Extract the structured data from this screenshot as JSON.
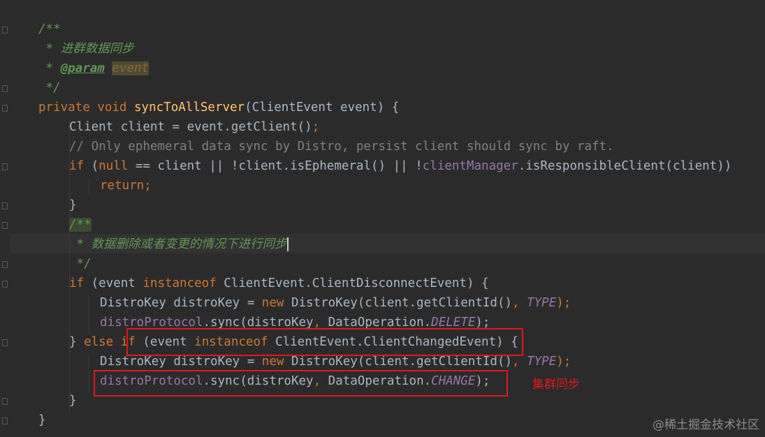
{
  "code": {
    "l1": "/**",
    "l2": " * 进群数据同步",
    "l3a": " * ",
    "l3_tag": "@param",
    "l3_sp": " ",
    "l3_val": "event",
    "l4": " */",
    "l5_kw1": "private",
    "l5_kw2": "void",
    "l5_fn": "syncToAllServer",
    "l5_rest": "(ClientEvent event) {",
    "l6_a": "Client client = event.getClient()",
    "l6_b": ";",
    "l7": "// Only ephemeral data sync by Distro, persist client should sync by raft.",
    "l8_if": "if",
    "l8_a": " (",
    "l8_null": "null",
    "l8_b": " == client || !client.isEphemeral() || !",
    "l8_field": "clientManager",
    "l8_c": ".isResponsibleClient(client))",
    "l9": "return;",
    "l10": "}",
    "l11": "/**",
    "l12": " * 数据删除或者变更的情况下进行同步",
    "l13": " */",
    "l14_if": "if",
    "l14_a": " (event ",
    "l14_inst": "instanceof",
    "l14_b": " ClientEvent.ClientDisconnectEvent) {",
    "l15_a": "DistroKey distroKey = ",
    "l15_new": "new",
    "l15_b": " DistroKey(client.getClientId()",
    "l15_comma": ",",
    "l15_type": " TYPE",
    "l15_semi": ");",
    "l16_field": "distroProtocol",
    "l16_a": ".sync(distroKey",
    "l16_comma": ",",
    "l16_b": " DataOperation.",
    "l16_const": "DELETE",
    "l16_c": ");",
    "l17_a": "} ",
    "l17_else": "else",
    "l17_sp": " ",
    "l17_if": "if",
    "l17_b": " (event ",
    "l17_inst": "instanceof",
    "l17_c": " ClientEvent.ClientChangedEvent) {",
    "l18_a": "DistroKey distroKey = ",
    "l18_new": "new",
    "l18_b": " DistroKey(client.getClientId()",
    "l18_comma": ",",
    "l18_type": " TYPE",
    "l18_semi": ");",
    "l19_field": "distroProtocol",
    "l19_a": ".sync(distroKey",
    "l19_comma": ",",
    "l19_b": " DataOperation.",
    "l19_const": "CHANGE",
    "l19_c": ");",
    "l20": "}",
    "l21": "}"
  },
  "annotation": "集群同步",
  "watermark": "@稀土掘金技术社区",
  "colors": {
    "background": "#2b2b2b",
    "keyword": "#cc7832",
    "method": "#ffc66d",
    "doc_comment": "#629755",
    "line_comment": "#808080",
    "field": "#9876aa",
    "default_text": "#a9b7c6",
    "highlight_box": "#e0181c"
  }
}
